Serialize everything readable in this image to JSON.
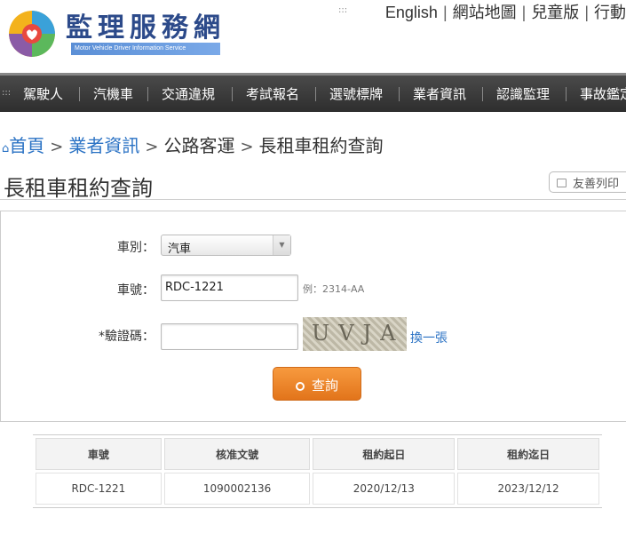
{
  "header": {
    "logo_title": "監理服務網",
    "logo_subtitle": "Motor Vehicle Driver Information Service",
    "top_links": [
      "English",
      "網站地圖",
      "兒童版",
      "行動"
    ]
  },
  "nav": {
    "items": [
      "駕駛人",
      "汽機車",
      "交通違規",
      "考試報名",
      "選號標牌",
      "業者資訊",
      "認識監理",
      "事故鑑定"
    ]
  },
  "breadcrumb": {
    "home": "首頁",
    "level1": "業者資訊",
    "level2": "公路客運",
    "current": "長租車租約查詢"
  },
  "page": {
    "title": "長租車租約查詢",
    "print_label": "友善列印"
  },
  "form": {
    "vehicle_type_label": "車別：",
    "vehicle_type_value": "汽車",
    "plate_label": "車號：",
    "plate_value": "RDC-1221",
    "plate_hint": "例：2314-AA",
    "captcha_label": "*驗證碼：",
    "captcha_value": "",
    "captcha_text": "UVJA",
    "refresh_label": "換一張",
    "submit_label": "查詢"
  },
  "results": {
    "headers": [
      "車號",
      "核准文號",
      "租約起日",
      "租約迄日"
    ],
    "rows": [
      [
        "RDC-1221",
        "1090002136",
        "2020/12/13",
        "2023/12/12"
      ]
    ]
  },
  "colors": {
    "link": "#2a72c4",
    "nav_bg": "#3a3a3a",
    "button": "#ec8428",
    "brand": "#2c4a8a"
  }
}
